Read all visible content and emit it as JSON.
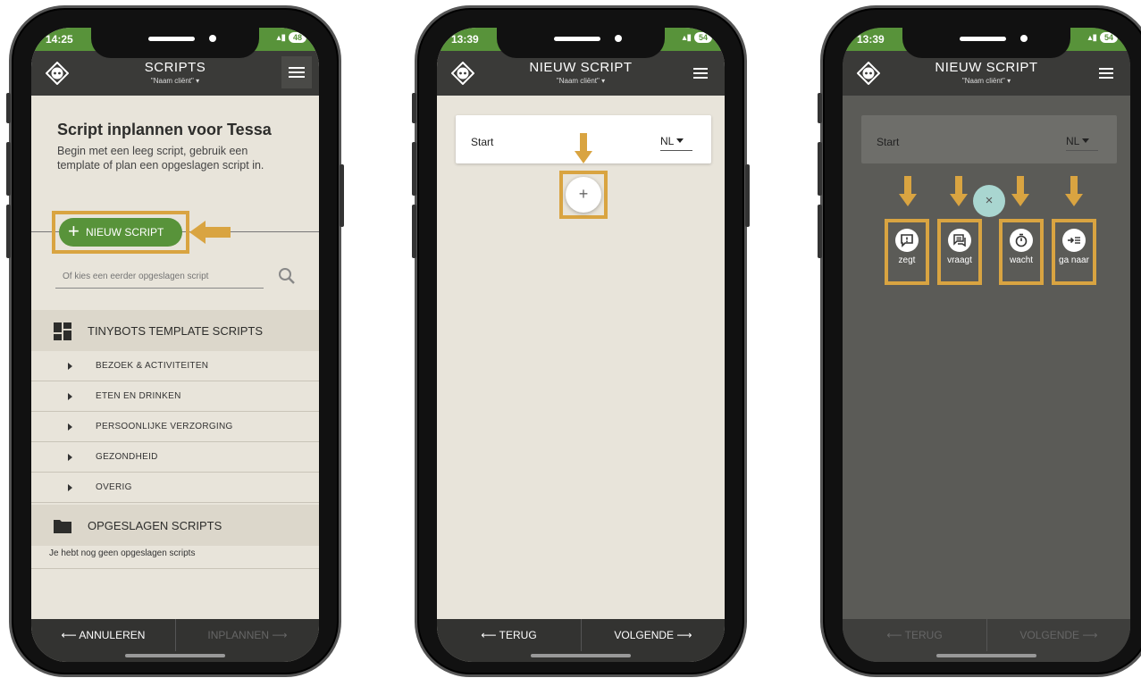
{
  "phones": [
    {
      "status": {
        "time": "14:25",
        "battery": "48"
      },
      "header": {
        "title": "SCRIPTS",
        "client": "\"Naam cliënt\""
      },
      "heading": "Script inplannen voor Tessa",
      "intro": "Begin met een leeg script, gebruik een template of plan een opgeslagen script in.",
      "new_script_label": "NIEUW SCRIPT",
      "search": {
        "placeholder": "Of kies een eerder opgeslagen script"
      },
      "template_section": {
        "title": "TINYBOTS TEMPLATE SCRIPTS",
        "items": [
          "BEZOEK & ACTIVITEITEN",
          "ETEN EN DRINKEN",
          "PERSOONLIJKE VERZORGING",
          "GEZONDHEID",
          "OVERIG"
        ]
      },
      "saved_section": {
        "title": "OPGESLAGEN SCRIPTS",
        "empty_text": "Je hebt nog geen opgeslagen scripts"
      },
      "footer": {
        "left": "⟵ ANNULEREN",
        "right": "INPLANNEN ⟶"
      }
    },
    {
      "status": {
        "time": "13:39",
        "battery": "54"
      },
      "header": {
        "title": "NIEUW SCRIPT",
        "client": "\"Naam cliënt\""
      },
      "start_card": {
        "label": "Start",
        "language": "NL"
      },
      "add_symbol": "+",
      "footer": {
        "left": "⟵ TERUG",
        "right": "VOLGENDE ⟶"
      }
    },
    {
      "status": {
        "time": "13:39",
        "battery": "54"
      },
      "header": {
        "title": "NIEUW SCRIPT",
        "client": "\"Naam cliënt\""
      },
      "start_card": {
        "label": "Start",
        "language": "NL"
      },
      "close_symbol": "×",
      "actions": [
        {
          "label": "zegt",
          "icon": "speech-alert-icon"
        },
        {
          "label": "vraagt",
          "icon": "chat-question-icon"
        },
        {
          "label": "wacht",
          "icon": "stopwatch-icon"
        },
        {
          "label": "ga naar",
          "icon": "goto-icon"
        }
      ],
      "footer": {
        "left": "⟵ TERUG",
        "right": "VOLGENDE ⟶"
      }
    }
  ],
  "colors": {
    "accent_green": "#58933a",
    "highlight_gold": "#d9a441",
    "appbar": "#3a3a38",
    "close_teal": "#a9d6d0"
  }
}
